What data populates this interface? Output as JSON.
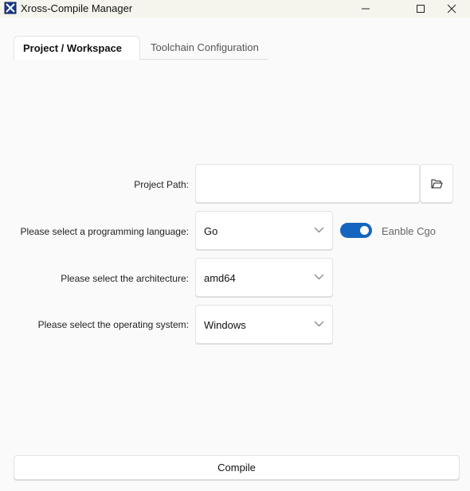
{
  "window": {
    "title": "Xross-Compile Manager",
    "controls": {
      "minimize": "minimize-icon",
      "maximize": "maximize-icon",
      "close": "close-icon"
    }
  },
  "tabs": [
    {
      "label": "Project / Workspace",
      "active": true
    },
    {
      "label": "Toolchain Configuration",
      "active": false
    }
  ],
  "form": {
    "project_path": {
      "label": "Project Path:",
      "value": "",
      "placeholder": "",
      "browse_icon": "folder-open-icon"
    },
    "language": {
      "label": "Please select a programming language:",
      "value": "Go"
    },
    "cgo": {
      "label": "Eanble Cgo",
      "checked": true
    },
    "architecture": {
      "label": "Please select the architecture:",
      "value": "amd64"
    },
    "os": {
      "label": "Please select the operating system:",
      "value": "Windows"
    }
  },
  "compile_button": {
    "label": "Compile"
  },
  "colors": {
    "accent": "#1565c0",
    "background": "#fafafa",
    "titlebar": "#f5f5ee"
  }
}
